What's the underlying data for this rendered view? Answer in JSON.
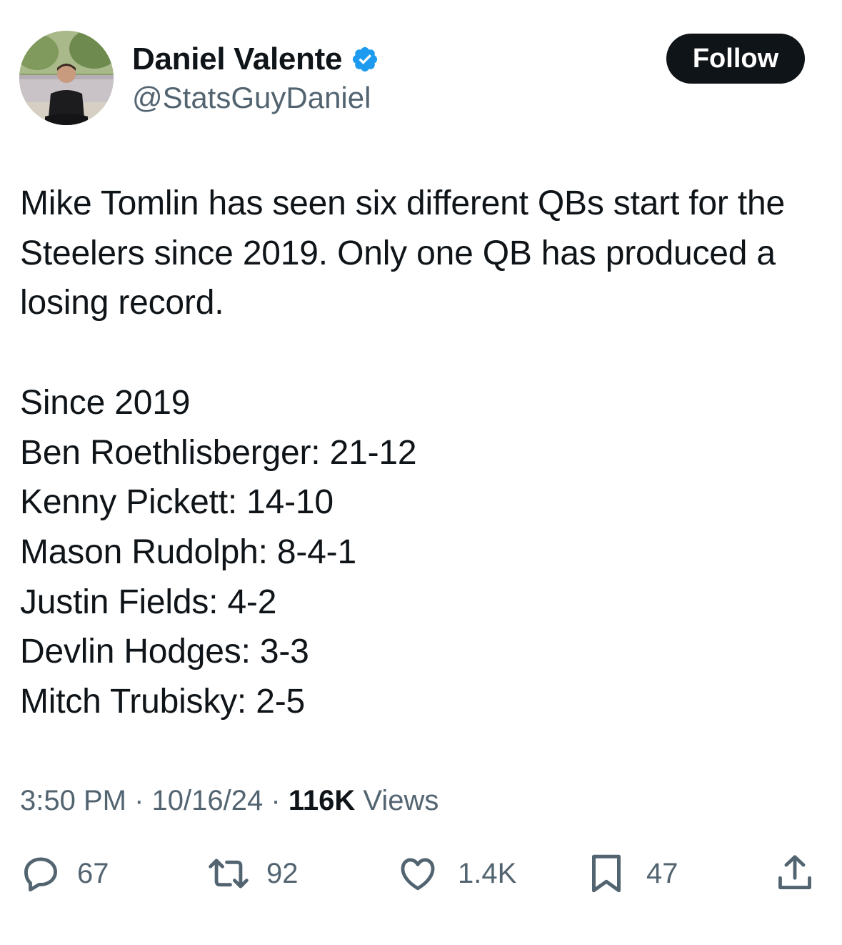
{
  "author": {
    "display_name": "Daniel Valente",
    "handle": "@StatsGuyDaniel",
    "verified": true
  },
  "follow_label": "Follow",
  "tweet": {
    "lines": [
      "Mike Tomlin has seen six different QBs start for the Steelers since 2019. Only one QB has produced a losing record.",
      "",
      "Since 2019",
      "Ben Roethlisberger: 21-12",
      "Kenny Pickett: 14-10",
      "Mason Rudolph: 8-4-1",
      "Justin Fields: 4-2",
      "Devlin Hodges: 3-3",
      "Mitch Trubisky: 2-5"
    ]
  },
  "meta": {
    "time": "3:50 PM",
    "separator": "·",
    "date": "10/16/24",
    "views_count": "116K",
    "views_label": "Views"
  },
  "actions": {
    "replies": "67",
    "reposts": "92",
    "likes": "1.4K",
    "bookmarks": "47"
  },
  "colors": {
    "text": "#0f1419",
    "secondary": "#536471",
    "verified_blue": "#1d9bf0",
    "button_bg": "#0f1419"
  }
}
